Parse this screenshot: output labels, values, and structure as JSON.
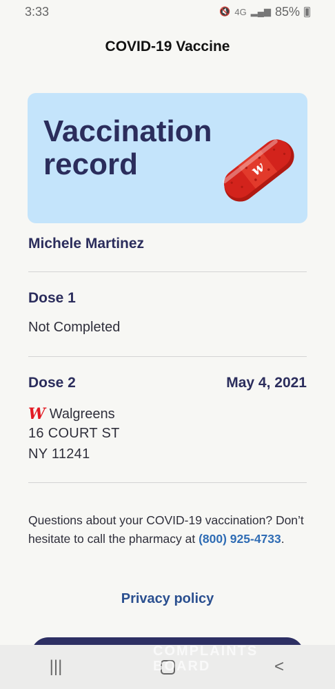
{
  "status_bar": {
    "time": "3:33",
    "network": "4G",
    "battery": "85%",
    "icons": [
      "mute-icon",
      "signal-icon",
      "battery-icon"
    ]
  },
  "header": {
    "title": "COVID-19 Vaccine"
  },
  "hero": {
    "title_line1": "Vaccination",
    "title_line2": "record",
    "colors": {
      "background": "#c4e4fb",
      "bandage": "#d3231c"
    }
  },
  "patient": {
    "name": "Michele Martinez"
  },
  "doses": [
    {
      "label": "Dose 1",
      "status": "Not Completed"
    },
    {
      "label": "Dose 2",
      "date": "May 4, 2021",
      "pharmacy": "Walgreens",
      "address_line1": "16 COURT ST",
      "address_line2": "NY 11241"
    }
  ],
  "footer": {
    "questions_text": "Questions about your COVID-19 vaccination? Don’t hesitate to call the pharmacy at ",
    "phone": "(800) 925-4733",
    "trailing": ".",
    "privacy_label": "Privacy policy"
  },
  "watermark": {
    "line1": "COMPLAINTS",
    "line2": "BOARD"
  },
  "nav": {
    "recents": "|||",
    "back": "<"
  }
}
